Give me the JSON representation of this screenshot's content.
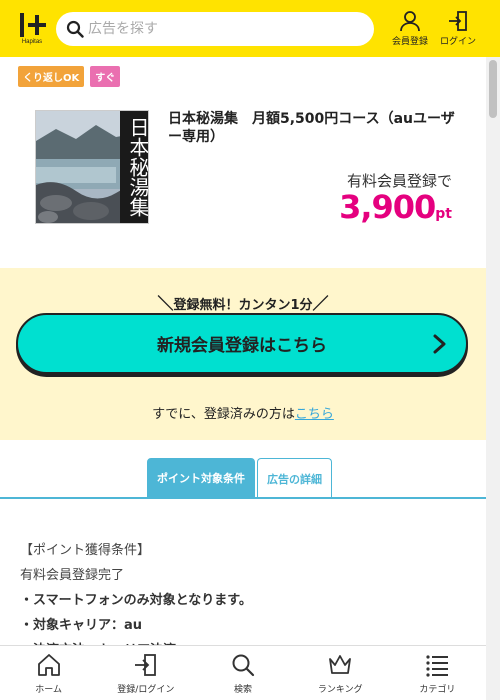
{
  "header": {
    "logo_text": "Hapitas",
    "search_placeholder": "広告を探す",
    "register_label": "会員登録",
    "login_label": "ログイン"
  },
  "tags": [
    "くり返しOK",
    "すぐ"
  ],
  "product": {
    "image_text": "日本秘湯集",
    "title": "日本秘湯集　月額5,500円コース（auユーザー専用）",
    "condition": "有料会員登録で",
    "points": "3,900",
    "points_unit": "pt"
  },
  "signup": {
    "note": "登録無料！カンタン1分",
    "cta_label": "新規会員登録はこちら",
    "already_prefix": "すでに、登録済みの方は",
    "already_link": "こちら"
  },
  "tabs": [
    "ポイント対象条件",
    "広告の詳細"
  ],
  "conditions": [
    {
      "text": "【ポイント獲得条件】",
      "bold": false
    },
    {
      "text": "有料会員登録完了",
      "bold": false
    },
    {
      "text": "・スマートフォンのみ対象となります。",
      "bold": true
    },
    {
      "text": "・対象キャリア：au",
      "bold": true
    },
    {
      "text": "・決済方法：キャリア決済",
      "bold": true
    }
  ],
  "bottom_nav": [
    "ホーム",
    "登録/ログイン",
    "検索",
    "ランキング",
    "カテゴリ"
  ],
  "colors": {
    "header_bg": "#ffe300",
    "cta_bg": "#00e0d0",
    "points": "#e5007f",
    "tab_accent": "#4db6d6",
    "signup_bg": "#fff6cc"
  }
}
